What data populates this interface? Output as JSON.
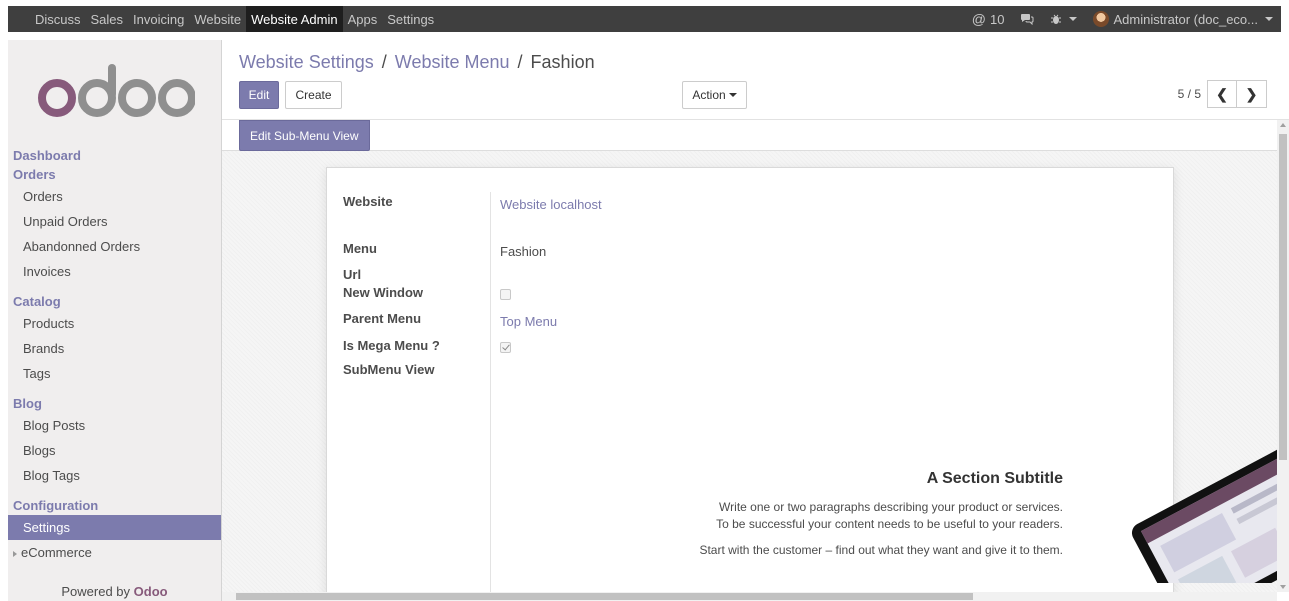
{
  "topbar": {
    "menu": [
      "Discuss",
      "Sales",
      "Invoicing",
      "Website",
      "Website Admin",
      "Apps",
      "Settings"
    ],
    "active_index": 4,
    "messages_count": "10",
    "user": "Administrator (doc_eco..."
  },
  "sidebar": {
    "logo": "odoo",
    "sections": [
      {
        "heading": "Dashboard",
        "items": []
      },
      {
        "heading": "Orders",
        "items": [
          "Orders",
          "Unpaid Orders",
          "Abandonned Orders",
          "Invoices"
        ]
      },
      {
        "heading": "Catalog",
        "items": [
          "Products",
          "Brands",
          "Tags"
        ]
      },
      {
        "heading": "Blog",
        "items": [
          "Blog Posts",
          "Blogs",
          "Blog Tags"
        ]
      },
      {
        "heading": "Configuration",
        "items": [
          "Settings"
        ]
      }
    ],
    "collapsed_item": "eCommerce",
    "active_item": "Settings",
    "powered_by": "Powered by",
    "powered_brand": "Odoo"
  },
  "control": {
    "breadcrumb": [
      "Website Settings",
      "Website Menu",
      "Fashion"
    ],
    "edit_label": "Edit",
    "create_label": "Create",
    "action_label": "Action",
    "pager": "5 / 5"
  },
  "statusbar": {
    "edit_submenu_label": "Edit Sub-Menu View"
  },
  "form": {
    "website_label": "Website",
    "website_value": "Website localhost",
    "menu_label": "Menu",
    "menu_value": "Fashion",
    "url_label": "Url",
    "new_window_label": "New Window",
    "new_window_checked": false,
    "parent_menu_label": "Parent Menu",
    "parent_menu_value": "Top Menu",
    "mega_menu_label": "Is Mega Menu ?",
    "mega_menu_checked": true,
    "submenu_view_label": "SubMenu View"
  },
  "submenu_preview": {
    "subtitle": "A Section Subtitle",
    "para1": "Write one or two paragraphs describing your product or services.",
    "para2": "To be successful your content needs to be useful to your readers.",
    "para3": "Start with the customer – find out what they want and give it to them."
  },
  "colors": {
    "accent": "#7c7bad",
    "brand": "#875a7b",
    "topbar": "#3f3f3f"
  }
}
